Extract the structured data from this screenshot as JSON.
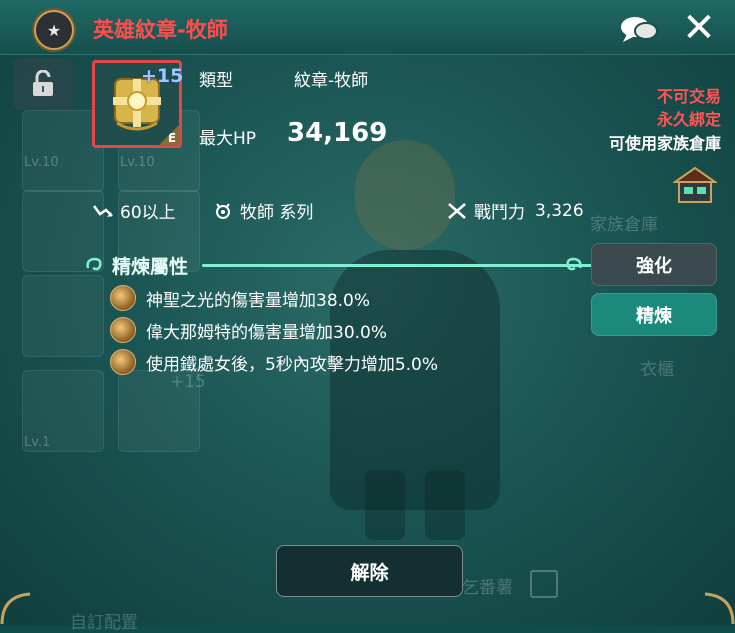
{
  "window": {
    "title": "英雄紋章-牧師",
    "title_color": "#ff4d4d"
  },
  "item": {
    "enhance_level": "+15",
    "grade_letter": "E",
    "type_label": "類型",
    "type_value": "紋章-牧師",
    "hp_label": "最大HP",
    "hp_value": "34,169",
    "level_req": "60以上",
    "class_req": "牧師 系列",
    "power_label": "戰鬥力",
    "power_value": "3,326"
  },
  "restrictions": {
    "trade": "不可交易",
    "bind": "永久綁定",
    "storage": "可使用家族倉庫"
  },
  "refine": {
    "title": "精煉屬性",
    "attributes": [
      "神聖之光的傷害量增加38.0%",
      "偉大那姆特的傷害量增加30.0%",
      "使用鐵處女後，5秒內攻擊力增加5.0%"
    ]
  },
  "buttons": {
    "enhance": "強化",
    "refine": "精煉",
    "release": "解除"
  },
  "background": {
    "lv_labels": [
      "Lv.10",
      "Lv.10",
      "Lv.1"
    ],
    "ghost_plus": "+15",
    "ghost_storage": "家族倉庫",
    "ghost_wardrobe": "衣櫃",
    "ghost_nickname": "乞番薯",
    "ghost_bottom_left": "自訂配置"
  },
  "icons": {
    "window": "star-badge-icon",
    "chat": "chat-bubble-icon",
    "close": "close-icon",
    "lock": "unlock-icon",
    "level": "level-arrow-icon",
    "class": "class-emblem-icon",
    "power": "crossed-swords-icon",
    "refine": "swirl-icon",
    "attribute": "gold-orb-icon",
    "storage": "house-storage-icon"
  },
  "colors": {
    "accent_red": "#ff5555",
    "refine_button": "#1b8a7c",
    "enhance_button": "#3a4a4e",
    "refine_line": "#7ff0d0"
  }
}
